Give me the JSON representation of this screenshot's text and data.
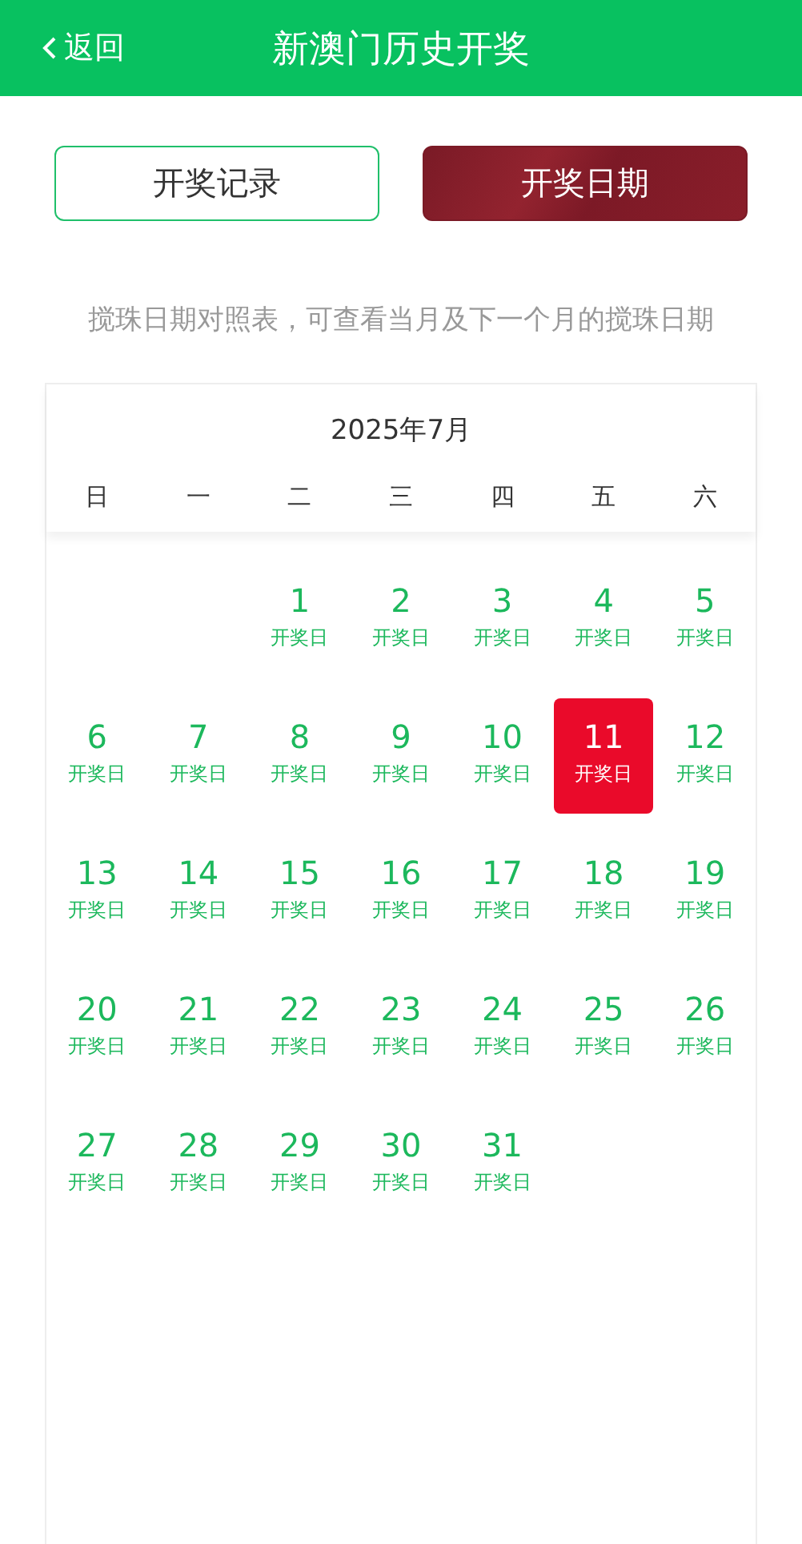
{
  "header": {
    "back": "返回",
    "title": "新澳门历史开奖"
  },
  "tabs": [
    {
      "label": "开奖记录",
      "selected": false
    },
    {
      "label": "开奖日期",
      "selected": true
    }
  ],
  "hint": "搅珠日期对照表，可查看当月及下一个月的搅珠日期",
  "calendar": {
    "month": "2025年7月",
    "weekdays": [
      "日",
      "一",
      "二",
      "三",
      "四",
      "五",
      "六"
    ],
    "weeks": [
      [
        {
          "kind": "blank"
        },
        {
          "kind": "blank"
        },
        {
          "kind": "day",
          "day": "1",
          "label": "开奖日",
          "selected": false
        },
        {
          "kind": "day",
          "day": "2",
          "label": "开奖日",
          "selected": false
        },
        {
          "kind": "day",
          "day": "3",
          "label": "开奖日",
          "selected": false
        },
        {
          "kind": "day",
          "day": "4",
          "label": "开奖日",
          "selected": false
        },
        {
          "kind": "day",
          "day": "5",
          "label": "开奖日",
          "selected": false
        }
      ],
      [
        {
          "kind": "day",
          "day": "6",
          "label": "开奖日",
          "selected": false
        },
        {
          "kind": "day",
          "day": "7",
          "label": "开奖日",
          "selected": false
        },
        {
          "kind": "day",
          "day": "8",
          "label": "开奖日",
          "selected": false
        },
        {
          "kind": "day",
          "day": "9",
          "label": "开奖日",
          "selected": false
        },
        {
          "kind": "day",
          "day": "10",
          "label": "开奖日",
          "selected": false
        },
        {
          "kind": "day",
          "day": "11",
          "label": "开奖日",
          "selected": true
        },
        {
          "kind": "day",
          "day": "12",
          "label": "开奖日",
          "selected": false
        }
      ],
      [
        {
          "kind": "day",
          "day": "13",
          "label": "开奖日",
          "selected": false
        },
        {
          "kind": "day",
          "day": "14",
          "label": "开奖日",
          "selected": false
        },
        {
          "kind": "day",
          "day": "15",
          "label": "开奖日",
          "selected": false
        },
        {
          "kind": "day",
          "day": "16",
          "label": "开奖日",
          "selected": false
        },
        {
          "kind": "day",
          "day": "17",
          "label": "开奖日",
          "selected": false
        },
        {
          "kind": "day",
          "day": "18",
          "label": "开奖日",
          "selected": false
        },
        {
          "kind": "day",
          "day": "19",
          "label": "开奖日",
          "selected": false
        }
      ],
      [
        {
          "kind": "day",
          "day": "20",
          "label": "开奖日",
          "selected": false
        },
        {
          "kind": "day",
          "day": "21",
          "label": "开奖日",
          "selected": false
        },
        {
          "kind": "day",
          "day": "22",
          "label": "开奖日",
          "selected": false
        },
        {
          "kind": "day",
          "day": "23",
          "label": "开奖日",
          "selected": false
        },
        {
          "kind": "day",
          "day": "24",
          "label": "开奖日",
          "selected": false
        },
        {
          "kind": "day",
          "day": "25",
          "label": "开奖日",
          "selected": false
        },
        {
          "kind": "day",
          "day": "26",
          "label": "开奖日",
          "selected": false
        }
      ],
      [
        {
          "kind": "day",
          "day": "27",
          "label": "开奖日",
          "selected": false
        },
        {
          "kind": "day",
          "day": "28",
          "label": "开奖日",
          "selected": false
        },
        {
          "kind": "day",
          "day": "29",
          "label": "开奖日",
          "selected": false
        },
        {
          "kind": "day",
          "day": "30",
          "label": "开奖日",
          "selected": false
        },
        {
          "kind": "day",
          "day": "31",
          "label": "开奖日",
          "selected": false
        }
      ]
    ]
  }
}
